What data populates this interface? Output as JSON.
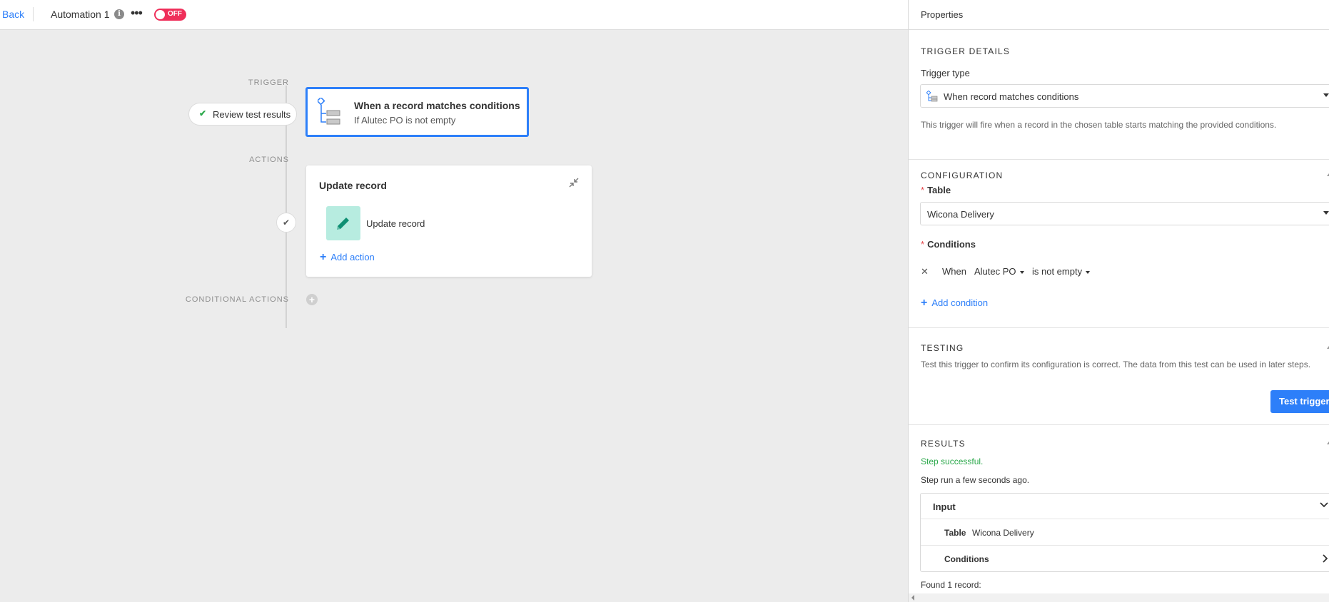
{
  "topbar": {
    "back_label": "Back",
    "automation_title": "Automation 1",
    "info_icon": "i",
    "more_icon": "•••",
    "toggle_label": "OFF"
  },
  "canvas": {
    "trigger_label": "TRIGGER",
    "actions_label": "ACTIONS",
    "conditional_label": "CONDITIONAL ACTIONS",
    "review_label": "Review test results",
    "trigger_card": {
      "title": "When a record matches conditions",
      "subtitle": "If Alutec PO is not empty"
    },
    "action_card": {
      "title": "Update record",
      "step_label": "Update record",
      "add_action_label": "Add action"
    }
  },
  "panel": {
    "title": "Properties",
    "trigger_details": {
      "heading": "TRIGGER DETAILS",
      "trigger_type_label": "Trigger type",
      "trigger_type_value": "When record matches conditions",
      "help": "This trigger will fire when a record in the chosen table starts matching the provided conditions."
    },
    "configuration": {
      "heading": "CONFIGURATION",
      "table_label": "Table",
      "table_value": "Wicona Delivery",
      "conditions_label": "Conditions",
      "condition": {
        "when": "When",
        "field": "Alutec PO",
        "operator": "is not empty"
      },
      "add_condition_label": "Add condition"
    },
    "testing": {
      "heading": "TESTING",
      "help": "Test this trigger to confirm its configuration is correct. The data from this test can be used in later steps.",
      "button_label": "Test trigger"
    },
    "results": {
      "heading": "RESULTS",
      "status": "Step successful.",
      "run_time": "Step run a few seconds ago.",
      "input_label": "Input",
      "table_key": "Table",
      "table_value": "Wicona Delivery",
      "conditions_key": "Conditions",
      "found": "Found 1 record:"
    }
  },
  "colors": {
    "accent": "#2d7ff9",
    "toggle_off": "#ef2f5a",
    "success": "#2aa84a",
    "tile": "#b7ece0"
  },
  "icons": [
    "info-icon",
    "more-icon",
    "check-icon",
    "trigger-conditions-icon",
    "collapse-icon",
    "pencil-icon",
    "plus-icon",
    "chevron-down-icon",
    "chevron-right-icon",
    "close-icon"
  ]
}
